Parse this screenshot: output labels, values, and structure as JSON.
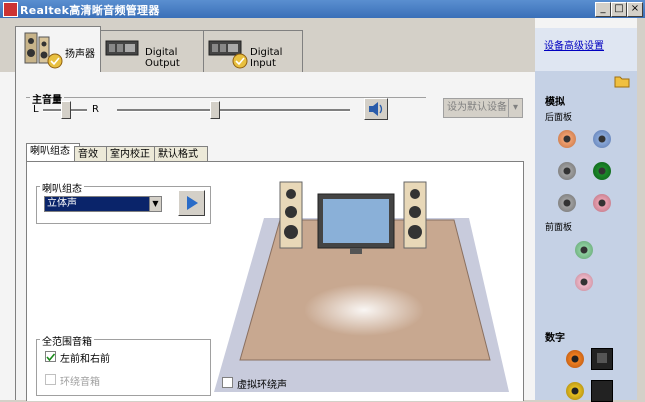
{
  "window": {
    "title": "Realtek高清晰音频管理器"
  },
  "device_tabs": [
    {
      "label": "扬声器"
    },
    {
      "label": "Digital Output"
    },
    {
      "label": "Digital Input"
    }
  ],
  "right_panel": {
    "advanced_link": "设备高级设置",
    "analog_label": "模拟",
    "rear_label": "后面板",
    "front_label": "前面板",
    "digital_label": "数字"
  },
  "volume": {
    "label": "主音量",
    "left_label": "L",
    "right_label": "R",
    "balance": 0.5,
    "level": 0.5
  },
  "default_device": {
    "label": "设为默认设备"
  },
  "inner_tabs": [
    {
      "label": "喇叭组态"
    },
    {
      "label": "音效"
    },
    {
      "label": "室内校正"
    },
    {
      "label": "默认格式"
    }
  ],
  "speaker_config": {
    "group_label": "喇叭组态",
    "selected": "立体声"
  },
  "fullrange": {
    "group_label": "全范围音箱",
    "front_label": "左前和右前",
    "front_checked": true,
    "surround_label": "环绕音箱",
    "surround_checked": false
  },
  "virtual_surround": {
    "label": "虚拟环绕声",
    "checked": false
  },
  "colors": {
    "title_blue": "#3a6fb8",
    "jack_orange": "#f0a070",
    "jack_blue": "#8aa8d8",
    "jack_gray": "#a0a0a0",
    "jack_green": "#1c8a2a",
    "jack_pink": "#e8a0b0",
    "floor": "#c8a890"
  }
}
